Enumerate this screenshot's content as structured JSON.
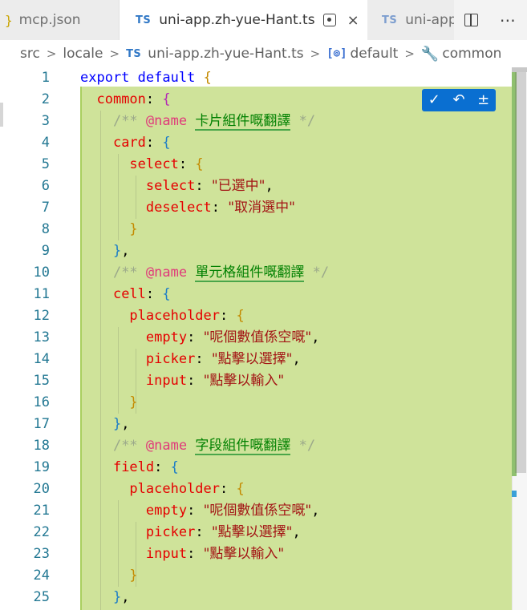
{
  "tabs": [
    {
      "icon": "}",
      "label": "mcp.json"
    },
    {
      "icon": "TS",
      "label": "uni-app.zh-yue-Hant.ts",
      "active": true
    },
    {
      "icon": "TS",
      "label": "uni-app"
    }
  ],
  "breadcrumb": {
    "seg1": "src",
    "seg2": "locale",
    "file_icon": "TS",
    "file": "uni-app.zh-yue-Hant.ts",
    "symbol_icon": "[⊚]",
    "symbol": "default",
    "member": "common",
    "separator": ">"
  },
  "gutter": {
    "numbers": [
      "1",
      "2",
      "3",
      "4",
      "5",
      "6",
      "7",
      "8",
      "9",
      "10",
      "11",
      "12",
      "13",
      "14",
      "15",
      "16",
      "17",
      "18",
      "19",
      "20",
      "21",
      "22",
      "23",
      "24",
      "25"
    ]
  },
  "code": {
    "export": "export",
    "default": "default",
    "common": "common",
    "card": "card",
    "select": "select",
    "deselect": "deselect",
    "cell": "cell",
    "field": "field",
    "placeholder": "placeholder",
    "empty": "empty",
    "picker": "picker",
    "input": "input",
    "comment_open": "/**",
    "comment_close": "*/",
    "name_tag": "@name",
    "card_comment": "卡片組件嘅翻譯",
    "cell_comment": "單元格組件嘅翻譯",
    "field_comment": "字段組件嘅翻譯",
    "str_selected": "\"已選中\"",
    "str_deselect": "\"取消選中\"",
    "str_empty": "\"呢個數值係空嘅\"",
    "str_picker": "\"點擊以選擇\"",
    "str_input": "\"點擊以輸入\""
  },
  "inline_actions": {
    "accept": "✓",
    "undo": "↶",
    "diff": "±"
  },
  "icons": {
    "split": "split-editor-icon",
    "more": "⋯",
    "close": "×",
    "wrench": "🔧"
  }
}
